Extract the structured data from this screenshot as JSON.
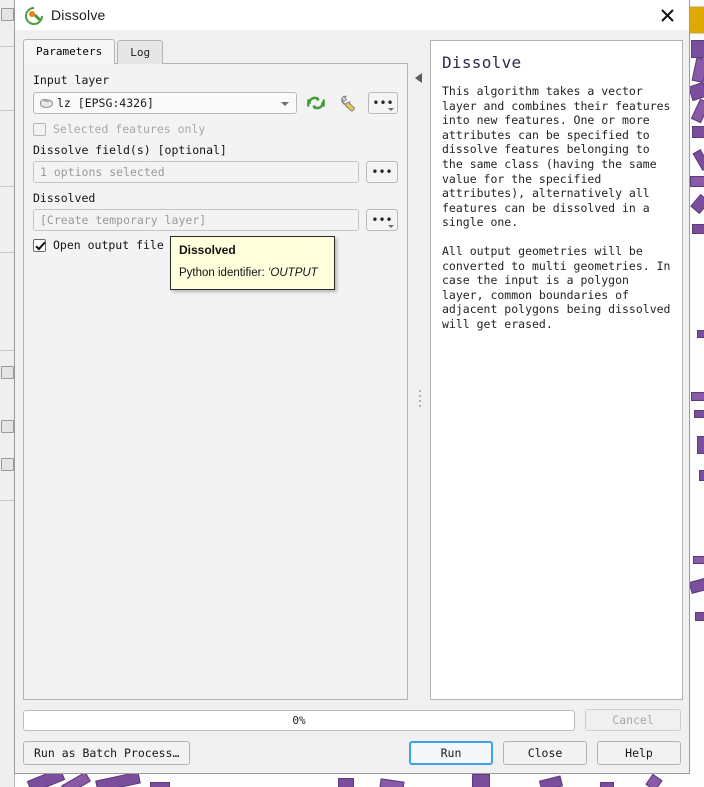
{
  "window": {
    "title": "Dissolve",
    "app_icon": "qgis-logo-icon",
    "close_icon": "close-icon"
  },
  "tabs": [
    {
      "label": "Parameters",
      "active": true
    },
    {
      "label": "Log",
      "active": false
    }
  ],
  "parameters": {
    "input_layer": {
      "label": "Input layer",
      "value": "lz [EPSG:4326]",
      "layer_icon": "polygon-layer-icon",
      "dropdown_icon": "chevron-down-icon",
      "iterate_icon": "iterate-features-icon",
      "advanced_icon": "wrench-icon",
      "browse_label": "•••"
    },
    "selected_features_only": {
      "label": "Selected features only",
      "checked": false,
      "enabled": false
    },
    "dissolve_fields": {
      "label": "Dissolve field(s) [optional]",
      "value": "1 options selected",
      "browse_label": "•••"
    },
    "dissolved": {
      "label": "Dissolved",
      "placeholder": "[Create temporary layer]",
      "value": "",
      "browse_label": "•••"
    },
    "open_output": {
      "label": "Open output file after running algorithm",
      "checked": true
    }
  },
  "tooltip": {
    "title": "Dissolved",
    "body_prefix": "Python identifier: ",
    "identifier": "‘OUTPUT"
  },
  "help": {
    "title": "Dissolve",
    "paragraphs": [
      "This algorithm takes a vector layer and combines their features into new features. One or more attributes can be specified to dissolve features belonging to the same class (having the same value for the specified attributes), alternatively all features can be dissolved in a single one.",
      "All output geometries will be converted to multi geometries. In case the input is a polygon layer, common boundaries of adjacent polygons being dissolved will get erased."
    ]
  },
  "splitter": {
    "collapse_icon": "collapse-left-arrow-icon",
    "grip_icon": "splitter-grip-icon"
  },
  "footer": {
    "progress_text": "0%",
    "progress_value": 0,
    "cancel_label": "Cancel",
    "batch_label": "Run as Batch Process…",
    "run_label": "Run",
    "close_label": "Close",
    "help_label": "Help"
  },
  "colors": {
    "accent": "#3da0e8",
    "dialog_bg": "#f0f0f0",
    "tooltip_bg": "#ffffdc",
    "map_feature": "#7a4e9c",
    "message_bar": "#e0a800",
    "qgis_green": "#4e9a3e",
    "qgis_orange": "#e8821a"
  }
}
